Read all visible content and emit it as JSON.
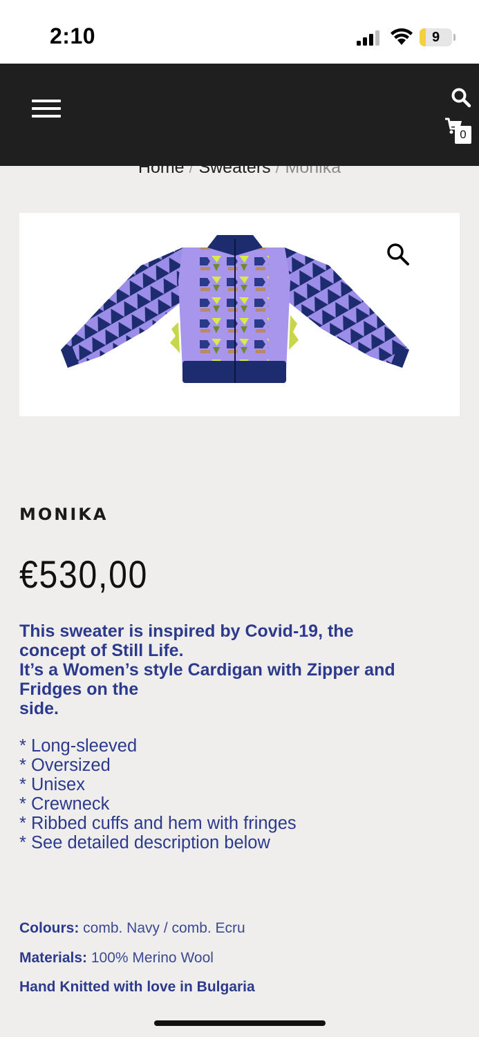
{
  "status_bar": {
    "time": "2:10",
    "battery_level": "9",
    "battery_fraction": 0.09,
    "battery_color": "#f4d03f"
  },
  "header": {
    "menu_icon": "hamburger-menu-icon",
    "search_icon": "search-icon",
    "cart_icon": "cart-icon",
    "cart_count": "0",
    "background": "#1f1f1f"
  },
  "breadcrumb": {
    "items": [
      "Home",
      "Sweaters",
      "Monika"
    ],
    "separator": "/"
  },
  "product": {
    "zoom_icon": "magnifier-icon",
    "title": "MONIKA",
    "price": "€530,00",
    "description_lines": [
      "This sweater is inspired by Covid-19, the",
      "concept of Still Life.",
      "It’s a Women’s style Cardigan with Zipper and",
      "Fridges on the",
      "side."
    ],
    "features": [
      "* Long-sleeved",
      "* Oversized",
      "* Unisex",
      "* Crewneck",
      "* Ribbed cuffs and hem with fringes",
      "* See detailed description below"
    ],
    "colours_label": "Colours:",
    "colours_value": " comb. Navy / comb. Ecru",
    "materials_label": "Materials:",
    "materials_value": " 100% Merino Wool",
    "origin": "Hand Knitted with love in Bulgaria",
    "accent_color": "#2b3a8c"
  }
}
